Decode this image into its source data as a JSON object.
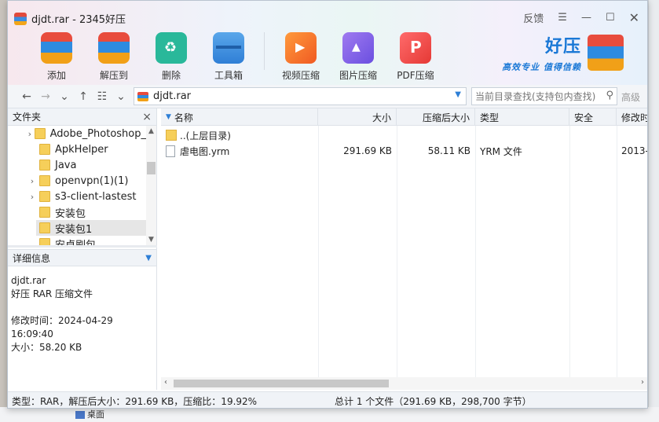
{
  "window": {
    "title": "djdt.rar - 2345好压",
    "feedback_label": "反馈",
    "menu_label": "☰",
    "minimize_label": "—",
    "maximize_label": "☐",
    "close_label": "✕"
  },
  "toolbar": {
    "add": "添加",
    "extract": "解压到",
    "delete": "删除",
    "toolbox": "工具箱",
    "video": "视频压缩",
    "image": "图片压缩",
    "pdf": "PDF压缩"
  },
  "brand": {
    "name": "好压",
    "slogan": "高效专业 值得信赖"
  },
  "address": {
    "path": "djdt.rar",
    "search_placeholder": "当前目录查找(支持包内查找)",
    "advanced": "高级"
  },
  "folder_pane": {
    "title": "文件夹",
    "close": "×",
    "items": [
      {
        "label": "Adobe_Photoshop_",
        "expandable": true
      },
      {
        "label": "ApkHelper",
        "expandable": false
      },
      {
        "label": "Java",
        "expandable": false
      },
      {
        "label": "openvpn(1)(1)",
        "expandable": true
      },
      {
        "label": "s3-client-lastest",
        "expandable": true
      },
      {
        "label": "安装包",
        "expandable": false
      },
      {
        "label": "安装包1",
        "expandable": false,
        "selected": true
      },
      {
        "label": "安卓刷包",
        "expandable": false
      }
    ]
  },
  "details": {
    "title": "详细信息",
    "filename": "djdt.rar",
    "filetype": "好压 RAR 压缩文件",
    "modified": "修改时间：2024-04-29 16:09:40",
    "size": "大小：58.20 KB"
  },
  "list": {
    "columns": {
      "name": "名称",
      "size": "大小",
      "compressed": "压缩后大小",
      "type": "类型",
      "security": "安全",
      "modified": "修改时"
    },
    "rows": [
      {
        "name": "..(上层目录)",
        "size": "",
        "compressed": "",
        "type": "",
        "security": "",
        "modified": "",
        "kind": "folder"
      },
      {
        "name": "虐电图.yrm",
        "size": "291.69 KB",
        "compressed": "58.11 KB",
        "type": "YRM 文件",
        "security": "",
        "modified": "2013-",
        "kind": "file"
      }
    ]
  },
  "status": {
    "left": "类型：RAR，解压后大小：291.69 KB，压缩比：19.92%",
    "right": "总计 1 个文件（291.69 KB，298,700 字节）"
  },
  "background": {
    "taskbar_item": "桌面"
  }
}
